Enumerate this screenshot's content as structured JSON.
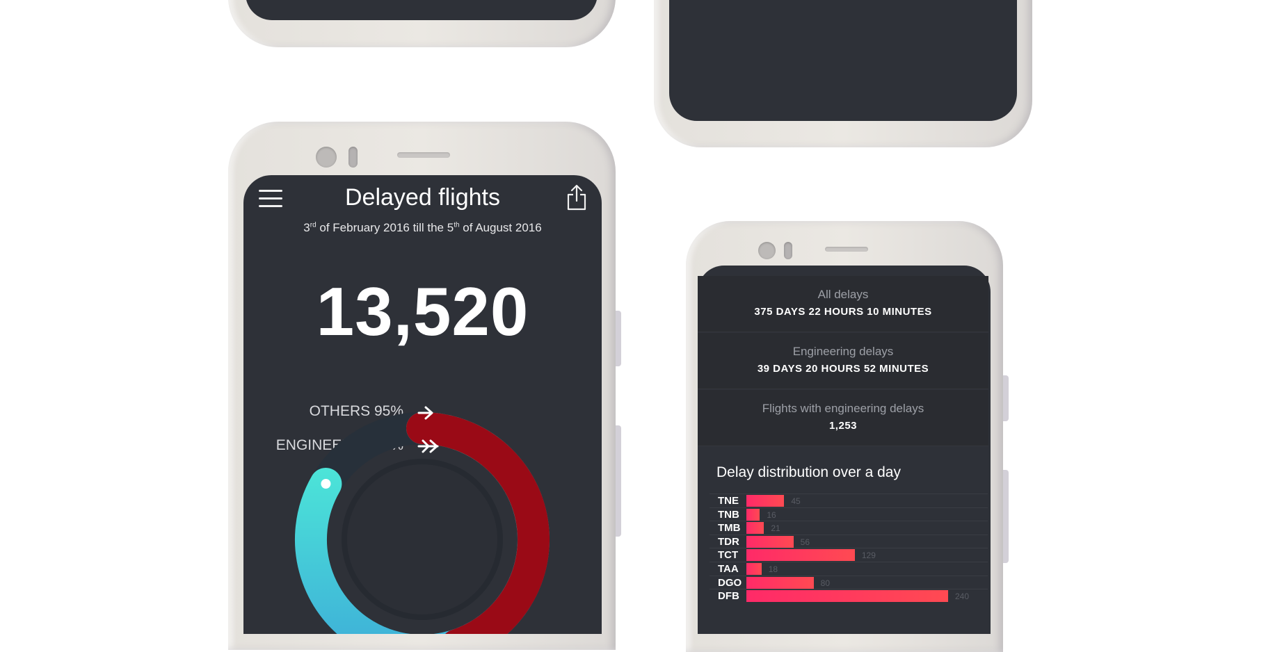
{
  "main_screen": {
    "title": "Delayed flights",
    "date_range": {
      "start_day": "3",
      "start_suffix": "rd",
      "start_rest": " of February 2016 till the ",
      "end_day": "5",
      "end_suffix": "th",
      "end_rest": " of August 2016"
    },
    "total_delayed": "13,520",
    "legend": {
      "others_label": "OTHERS 95%",
      "engineering_label": "ENGINEERING 5%"
    },
    "ring_chart": {
      "others_percent": 95,
      "engineering_percent": 5,
      "others_color": "#4ff0d8",
      "others_color_end": "#3eb0d8",
      "engineering_color": "#9a0a16"
    }
  },
  "stats_screen": {
    "stats": [
      {
        "label": "All delays",
        "value": "375 DAYS 22 HOURS 10 MINUTES"
      },
      {
        "label": "Engineering delays",
        "value": "39 DAYS 20 HOURS 52 MINUTES"
      },
      {
        "label": "Flights with engineering delays",
        "value": "1,253"
      }
    ],
    "bar_title": "Delay distribution over a day"
  },
  "chart_data": {
    "type": "bar",
    "orientation": "horizontal",
    "title": "Delay distribution over a day",
    "categories": [
      "TNE",
      "TNB",
      "TMB",
      "TDR",
      "TCT",
      "TAA",
      "DGO",
      "DFB"
    ],
    "values": [
      45,
      16,
      21,
      56,
      129,
      18,
      80,
      240
    ],
    "bar_color": "#ff2a68"
  },
  "colors": {
    "screen_bg": "#2e3138",
    "accent_pink": "#ff2a68",
    "accent_teal": "#4ff0d8",
    "accent_red": "#9a0a16"
  }
}
